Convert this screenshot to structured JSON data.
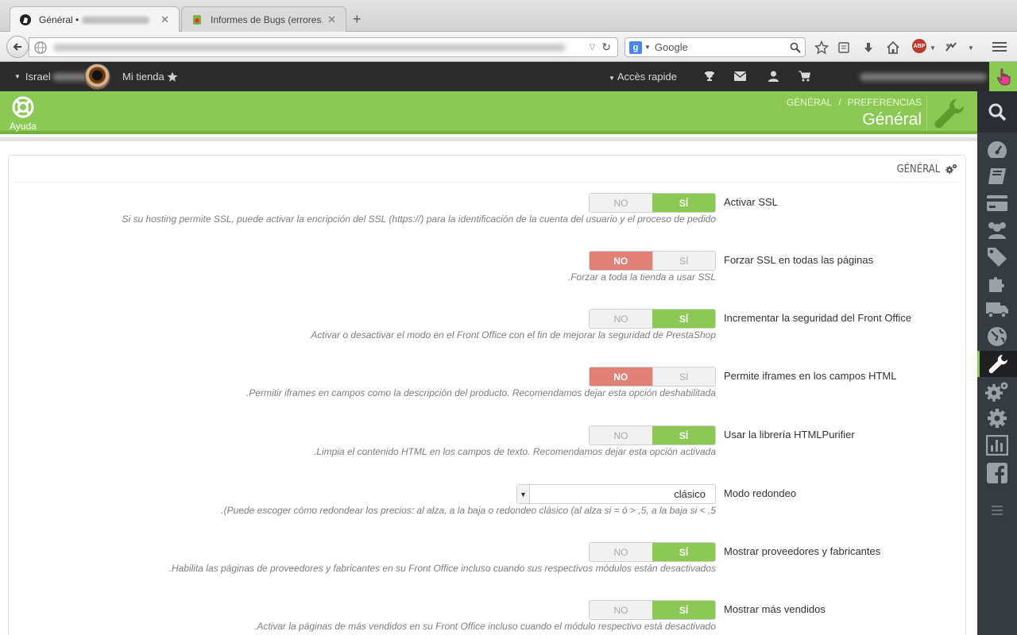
{
  "browser": {
    "tabs": [
      {
        "title": "Général •",
        "active": true
      },
      {
        "title": "Informes de Bugs (errores...",
        "active": false
      }
    ],
    "new_tab": "+",
    "search_placeholder": "Google",
    "search_engine_letter": "g",
    "adblock_label": "ABP"
  },
  "header": {
    "user_name": "Israel",
    "shop_label": "Mi tienda",
    "quick_access": "Accès rapide"
  },
  "toolbar": {
    "help_label": "Ayuda",
    "breadcrumb": [
      "GÉNÉRAL",
      "PREFERENCIAS"
    ],
    "breadcrumb_sep": "/",
    "page_title": "Général"
  },
  "panel": {
    "heading": "GÉNÉRAL",
    "no_label": "NO",
    "si_label": "SÍ",
    "settings": [
      {
        "label": "Activar SSL",
        "value": "SÍ",
        "help": "Si su hosting permite SSL, puede activar la encripción del SSL (https://) para la identificación de la cuenta del usuario y el proceso de pedido"
      },
      {
        "label": "Forzar SSL en todas las páginas",
        "value": "NO",
        "help": ".Forzar a toda la tienda a usar SSL"
      },
      {
        "label": "Incrementar la seguridad del Front Office",
        "value": "SÍ",
        "help": "Activar o desactivar el modo en el Front Office con el fin de mejorar la seguridad de PrestaShop"
      },
      {
        "label": "Permite iframes en los campos HTML",
        "value": "NO",
        "help": ".Permitir iframes en campos como la descripción del producto. Recomendamos dejar esta opción deshabilitada"
      },
      {
        "label": "Usar la librería HTMLPurifier",
        "value": "SÍ",
        "help": ".Limpia el contenido HTML en los campos de texto. Recomendamos dejar esta opción activada"
      },
      {
        "label": "Modo redondeo",
        "select_value": "clásico",
        "help": ".(Puede escoger cómo redondear los precios: al alza, a la baja o redondeo clásico (al alza si = ó > ,5, a la baja si < ,5"
      },
      {
        "label": "Mostrar proveedores y fabricantes",
        "value": "SÍ",
        "help": ".Habilita las páginas de proveedores y fabricantes en su Front Office incluso cuando sus respectivos módulos están desactivados"
      },
      {
        "label": "Mostrar más vendidos",
        "value": "SÍ",
        "help": ".Activar la páginas de más vendidos en su Front Office incluso cuando el módulo respectivo está desactivado"
      }
    ]
  },
  "colors": {
    "accent_green": "#8bc954",
    "no_red": "#e08077",
    "dark_header": "#2b2b2b",
    "sidebar": "#363a41"
  }
}
